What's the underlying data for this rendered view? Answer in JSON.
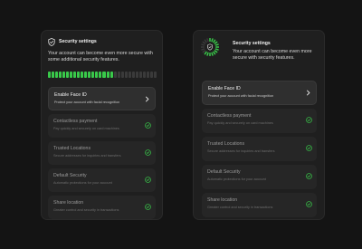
{
  "panels": [
    {
      "title": "Security settings",
      "description": "Your account can become even more secure with some additional security features.",
      "progress": {
        "filled": 18,
        "total": 30,
        "fraction": 0.6
      },
      "items": [
        {
          "title": "Enable Face ID",
          "subtitle": "Protect your account with facial recognition",
          "state": "active",
          "icon": "chevron-right-icon"
        },
        {
          "title": "Contactless payment",
          "subtitle": "Pay quickly and securely on card machines",
          "state": "done",
          "icon": "check-circle-icon"
        },
        {
          "title": "Trusted Locations",
          "subtitle": "Secure addresses for inquiries and transfers",
          "state": "done",
          "icon": "check-circle-icon"
        },
        {
          "title": "Default Security",
          "subtitle": "Automatic protections for your account",
          "state": "done",
          "icon": "check-circle-icon"
        },
        {
          "title": "Share location",
          "subtitle": "Greater control and security in transactions",
          "state": "done",
          "icon": "check-circle-icon"
        }
      ]
    },
    {
      "title": "Security settings",
      "description": "Your account can become even more secure with security features.",
      "progress": {
        "filled": 13,
        "total": 20,
        "fraction": 0.65
      },
      "items": [
        {
          "title": "Enable Face ID",
          "subtitle": "Protect your account with facial recognition",
          "state": "active",
          "icon": "chevron-right-icon"
        },
        {
          "title": "Contactless payment",
          "subtitle": "Pay quickly and securely on card machines",
          "state": "done",
          "icon": "check-circle-icon"
        },
        {
          "title": "Trusted Locations",
          "subtitle": "Secure addresses for inquiries and transfers",
          "state": "done",
          "icon": "check-circle-icon"
        },
        {
          "title": "Default Security",
          "subtitle": "Automatic protections for your account",
          "state": "done",
          "icon": "check-circle-icon"
        },
        {
          "title": "Share location",
          "subtitle": "Greater control and security in transactions",
          "state": "done",
          "icon": "check-circle-icon"
        }
      ]
    }
  ],
  "colors": {
    "accent": "#39c94a",
    "background": "#141414",
    "panel": "#1f1f1f",
    "track": "#3a3a3a"
  }
}
